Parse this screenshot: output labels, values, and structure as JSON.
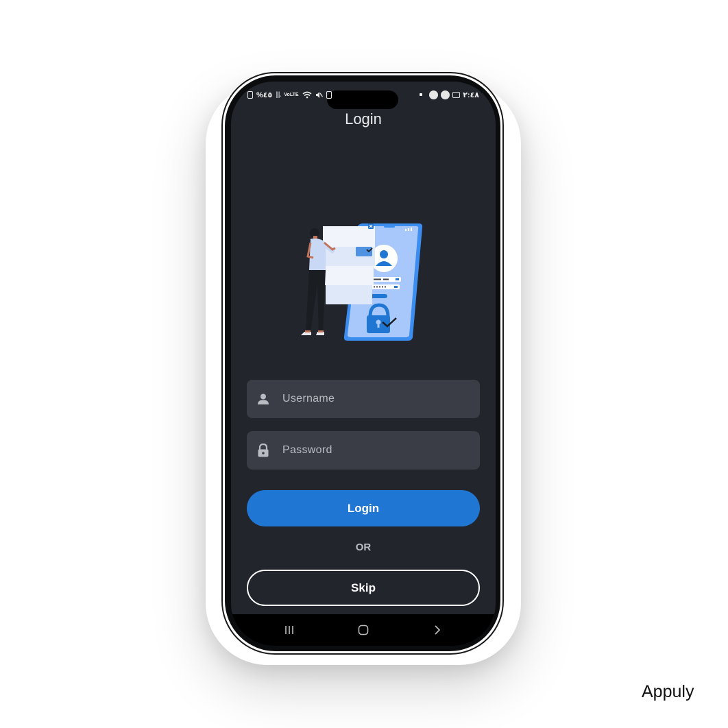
{
  "status_bar": {
    "left_text": "%٤٥",
    "signal_label": "VoLTE",
    "right_time": "٢:٤٨"
  },
  "header": {
    "title": "Login"
  },
  "illustration": {
    "name": "login-security-illustration"
  },
  "form": {
    "username": {
      "placeholder": "Username",
      "icon": "person-icon"
    },
    "password": {
      "placeholder": "Password",
      "icon": "lock-icon"
    }
  },
  "actions": {
    "login_label": "Login",
    "or_label": "OR",
    "skip_label": "Skip"
  },
  "nav": {
    "recents": "recents-icon",
    "home": "home-icon",
    "back": "back-icon"
  },
  "watermark": "Appuly",
  "colors": {
    "screen_bg": "#22252c",
    "field_bg": "#3a3d46",
    "primary": "#1f76d3",
    "text_muted": "#b9bcc2"
  }
}
